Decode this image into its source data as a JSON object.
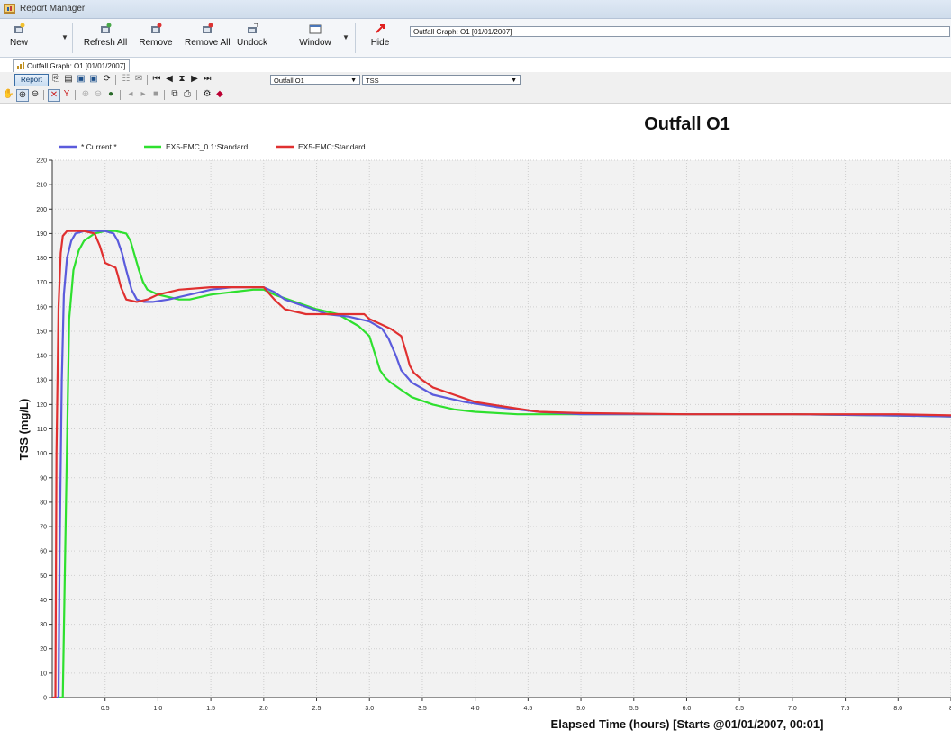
{
  "window": {
    "title": "Report Manager"
  },
  "ribbon": {
    "buttons": [
      {
        "key": "new",
        "label": "New",
        "icon": "new-report-icon"
      },
      {
        "key": "refresh_all",
        "label": "Refresh All",
        "icon": "refresh-all-icon"
      },
      {
        "key": "remove",
        "label": "Remove",
        "icon": "remove-icon"
      },
      {
        "key": "remove_all",
        "label": "Remove All",
        "icon": "remove-all-icon"
      },
      {
        "key": "undock",
        "label": "Undock",
        "icon": "undock-icon"
      },
      {
        "key": "window",
        "label": "Window",
        "icon": "window-icon"
      },
      {
        "key": "hide",
        "label": "Hide",
        "icon": "hide-icon"
      }
    ],
    "graph_selector": "Outfall Graph: O1 [01/01/2007]"
  },
  "document_tab": {
    "label": "Outfall Graph: O1 [01/01/2007]"
  },
  "report_toolbar": {
    "report_button": "Report",
    "location_combo": "Outfall O1",
    "parameter_combo": "TSS"
  },
  "chart_data": {
    "type": "line",
    "title": "Outfall O1",
    "xlabel": "Elapsed Time (hours) [Starts @01/01/2007, 00:01]",
    "ylabel": "TSS (mg/L)",
    "xlim": [
      0,
      8.5
    ],
    "ylim": [
      0,
      220
    ],
    "x_ticks": [
      "0.5",
      "1.0",
      "1.5",
      "2.0",
      "2.5",
      "3.0",
      "3.5",
      "4.0",
      "4.5",
      "5.0",
      "5.5",
      "6.0",
      "6.5",
      "7.0",
      "7.5",
      "8.0",
      "8"
    ],
    "y_ticks": [
      0,
      10,
      20,
      30,
      40,
      50,
      60,
      70,
      80,
      90,
      100,
      110,
      120,
      130,
      140,
      150,
      160,
      170,
      180,
      190,
      200,
      210,
      220
    ],
    "grid": true,
    "legend_position": "top-left",
    "series": [
      {
        "name": "* Current *",
        "color": "#5b5bdc",
        "x": [
          0.04,
          0.06,
          0.07,
          0.09,
          0.11,
          0.14,
          0.18,
          0.22,
          0.3,
          0.4,
          0.5,
          0.58,
          0.62,
          0.66,
          0.7,
          0.75,
          0.8,
          0.87,
          0.95,
          1.1,
          1.3,
          1.5,
          1.7,
          1.9,
          2.0,
          2.1,
          2.2,
          2.4,
          2.6,
          2.8,
          3.0,
          3.12,
          3.18,
          3.25,
          3.3,
          3.4,
          3.6,
          3.9,
          4.2,
          4.6,
          5.0,
          6.0,
          7.0,
          8.0,
          8.6
        ],
        "y": [
          0,
          0,
          60,
          130,
          165,
          180,
          187,
          190,
          191,
          191,
          191,
          190,
          187,
          182,
          175,
          167,
          163,
          162,
          162,
          163,
          165,
          167,
          168,
          168,
          168,
          166,
          163,
          160,
          157,
          156,
          154,
          151,
          147,
          140,
          134,
          129,
          124,
          121,
          119,
          117,
          116,
          116,
          116,
          115.5,
          115
        ]
      },
      {
        "name": "EX5-EMC_0.1:Standard",
        "color": "#2ee02e",
        "x": [
          0.06,
          0.08,
          0.1,
          0.13,
          0.16,
          0.2,
          0.25,
          0.3,
          0.4,
          0.5,
          0.6,
          0.7,
          0.74,
          0.78,
          0.82,
          0.86,
          0.9,
          0.95,
          1.0,
          1.1,
          1.2,
          1.3,
          1.5,
          1.7,
          1.9,
          2.0,
          2.1,
          2.3,
          2.5,
          2.7,
          2.9,
          3.0,
          3.05,
          3.1,
          3.15,
          3.2,
          3.3,
          3.4,
          3.6,
          3.8,
          4.0,
          4.4,
          5.0,
          6.0,
          7.0,
          8.0,
          8.6
        ],
        "y": [
          0,
          0,
          0,
          80,
          155,
          175,
          183,
          187,
          190,
          191,
          191,
          190,
          187,
          181,
          175,
          170,
          167,
          166,
          165,
          164,
          163,
          163,
          165,
          166,
          167,
          167,
          165,
          162,
          159,
          157,
          152,
          148,
          141,
          134,
          131,
          129,
          126,
          123,
          120,
          118,
          117,
          116,
          116,
          116,
          116,
          115.5,
          115
        ]
      },
      {
        "name": "EX5-EMC:Standard",
        "color": "#e03030",
        "x": [
          0.01,
          0.03,
          0.04,
          0.06,
          0.08,
          0.1,
          0.14,
          0.2,
          0.3,
          0.4,
          0.45,
          0.5,
          0.55,
          0.6,
          0.62,
          0.65,
          0.7,
          0.8,
          0.9,
          1.0,
          1.2,
          1.5,
          1.7,
          1.9,
          2.0,
          2.1,
          2.2,
          2.4,
          2.6,
          2.8,
          2.95,
          3.0,
          3.1,
          3.2,
          3.3,
          3.35,
          3.38,
          3.42,
          3.5,
          3.6,
          3.8,
          4.0,
          4.3,
          4.6,
          5.0,
          6.0,
          7.0,
          8.0,
          8.6
        ],
        "y": [
          0,
          0,
          100,
          160,
          182,
          189,
          191,
          191,
          191,
          190,
          185,
          178,
          177,
          176,
          173,
          168,
          163,
          162,
          163,
          165,
          167,
          168,
          168,
          168,
          168,
          163,
          159,
          157,
          157,
          157,
          157,
          155,
          153,
          151,
          148,
          141,
          136,
          133,
          130,
          127,
          124,
          121,
          119,
          117,
          116.5,
          116,
          116,
          116,
          115.5
        ]
      }
    ]
  }
}
